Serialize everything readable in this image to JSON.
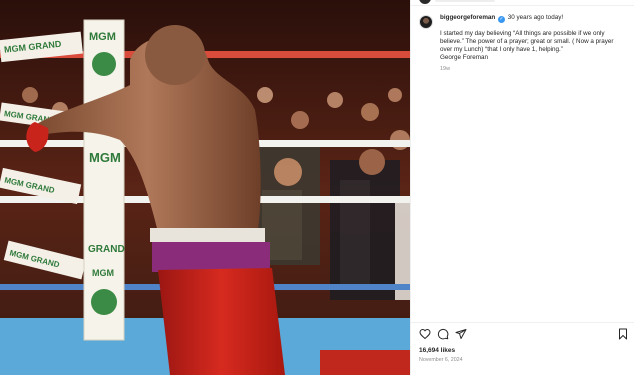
{
  "post": {
    "image_alt": "Boxer leaning on the ropes in the ring with crowd in background",
    "ring_banners": [
      "MGM GRAND",
      "MGM GRAND",
      "MGM GRAND",
      "MGM GRAND"
    ],
    "corner_pad_text": [
      "MGM",
      "MGM",
      "GRAND",
      "MGM"
    ]
  },
  "caption": {
    "username": "biggeorgeforeman",
    "verified_icon": "verified-badge-icon",
    "header_text": "30 years ago today!",
    "text": "I started my day believing “All things are possible if we only believe.” The power of a prayer; great or small. ( Now a prayer over my Lunch) “that I only have 1, helping.”\nGeorge Foreman",
    "time_ago": "19w"
  },
  "actions": {
    "like_icon": "heart-icon",
    "comment_icon": "comment-icon",
    "share_icon": "share-icon",
    "save_icon": "bookmark-icon"
  },
  "stats": {
    "likes": "16,694 likes",
    "date": "November 6, 2024"
  },
  "colors": {
    "accent": "#3897f0",
    "ring_blue": "#5aa9d8",
    "trunks_red": "#c0201a"
  }
}
